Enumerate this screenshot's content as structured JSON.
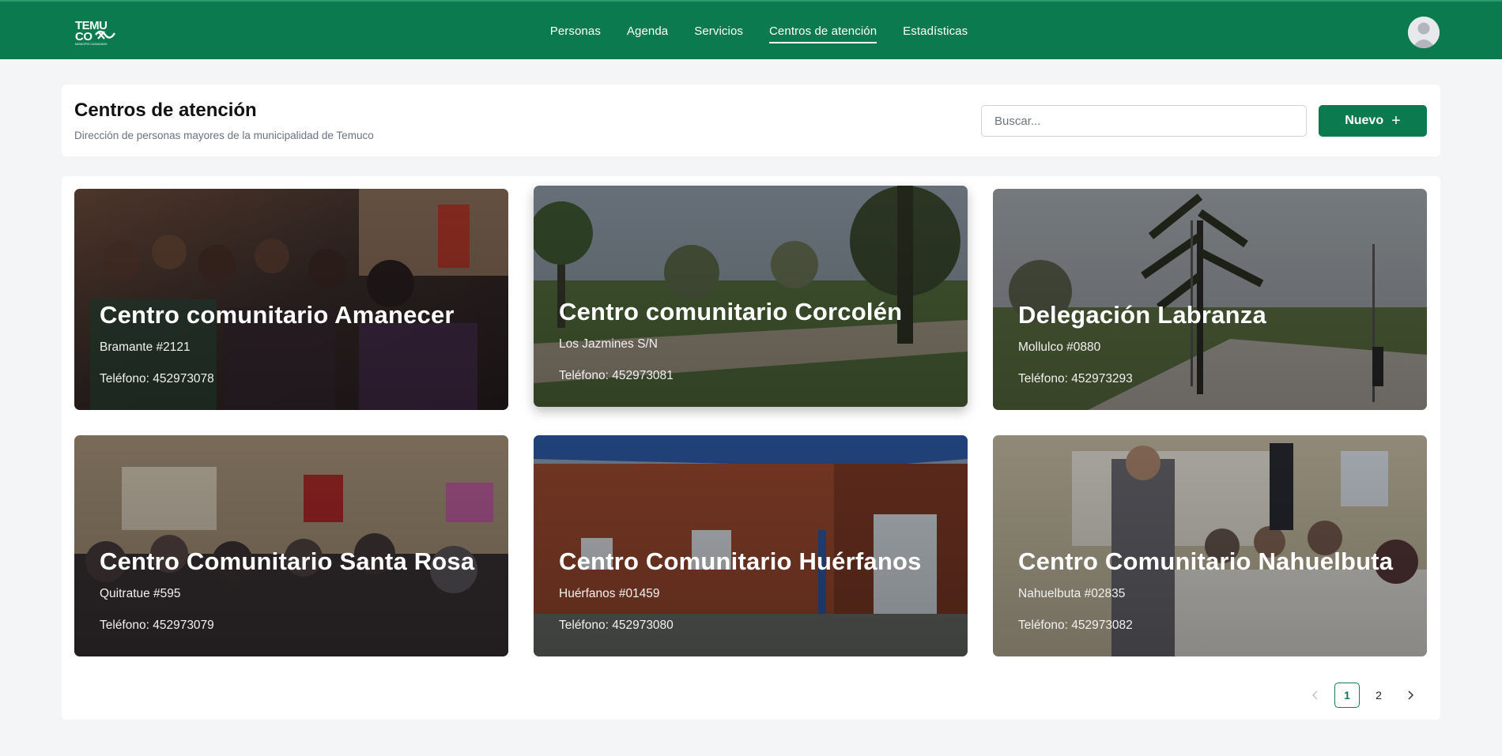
{
  "nav": {
    "logo_text": "TEMUCO",
    "logo_tagline": "MUNICIPIO CIUDADANO",
    "links": [
      {
        "label": "Personas"
      },
      {
        "label": "Agenda"
      },
      {
        "label": "Servicios"
      },
      {
        "label": "Centros de atención"
      },
      {
        "label": "Estadísticas"
      }
    ],
    "active": "Centros de atención",
    "avatar_icon": "user-avatar-icon"
  },
  "header": {
    "title": "Centros de atención",
    "subtitle": "Dirección de personas mayores de la municipalidad de Temuco",
    "search_placeholder": "Buscar...",
    "search_value": "",
    "new_label": "Nuevo"
  },
  "centers": [
    {
      "name": "Centro comunitario Amanecer",
      "address": "Bramante #2121",
      "phone": "Teléfono: 452973078"
    },
    {
      "name": "Centro comunitario Corcolén",
      "address": "Los Jazmines S/N",
      "phone": "Teléfono: 452973081"
    },
    {
      "name": "Delegación Labranza",
      "address": "Mollulco #0880",
      "phone": "Teléfono: 452973293"
    },
    {
      "name": "Centro Comunitario Santa Rosa",
      "address": "Quitratue #595",
      "phone": "Teléfono: 452973079"
    },
    {
      "name": "Centro Comunitario Huérfanos",
      "address": "Huérfanos #01459",
      "phone": "Teléfono: 452973080"
    },
    {
      "name": "Centro Comunitario Nahuelbuta",
      "address": "Nahuelbuta #02835",
      "phone": "Teléfono: 452973082"
    }
  ],
  "pagination": {
    "prev_icon": "chevron-left-icon",
    "pages": [
      "1",
      "2"
    ],
    "current": "1",
    "next_icon": "chevron-right-icon"
  },
  "colors": {
    "brand": "#0c7a4f",
    "background": "#f3f5f7"
  }
}
